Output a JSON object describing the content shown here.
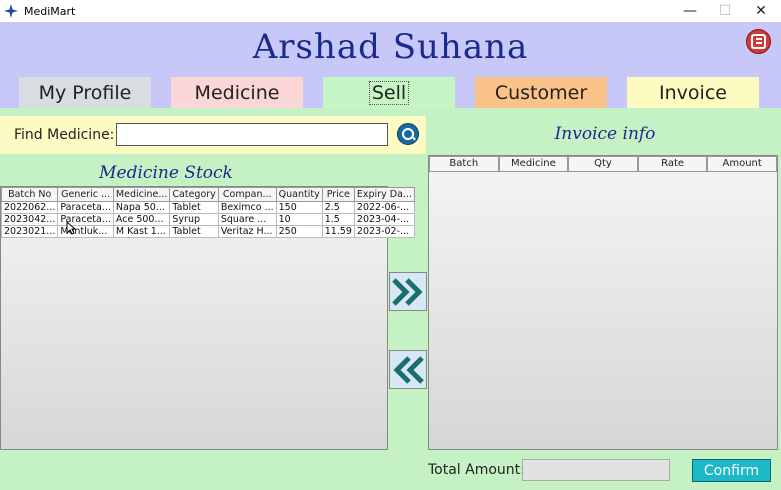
{
  "window": {
    "title": "MediMart",
    "minimize": "—",
    "maximize": "☐",
    "close": "✕"
  },
  "header": {
    "user_name": "Arshad Suhana"
  },
  "tabs": [
    {
      "label": "My Profile"
    },
    {
      "label": "Medicine"
    },
    {
      "label": "Sell"
    },
    {
      "label": "Customer"
    },
    {
      "label": "Invoice"
    }
  ],
  "find": {
    "label": "Find Medicine:",
    "value": ""
  },
  "stock": {
    "title": "Medicine Stock",
    "columns": [
      "Batch No",
      "Generic ...",
      "Medicine...",
      "Category",
      "Compan...",
      "Quantity",
      "Price",
      "Expiry Da..."
    ],
    "rows": [
      [
        "2022062...",
        "Paraceta...",
        "Napa 50...",
        "Tablet",
        "Beximco ...",
        "150",
        "2.5",
        "2022-06-..."
      ],
      [
        "2023042...",
        "Paraceta...",
        "Ace 500...",
        "Syrup",
        "Square ...",
        "10",
        "1.5",
        "2023-04-..."
      ],
      [
        "2023021...",
        "Montluk...",
        "M Kast 1...",
        "Tablet",
        "Veritaz H...",
        "250",
        "11.59",
        "2023-02-..."
      ]
    ]
  },
  "invoice": {
    "title": "Invoice info",
    "columns": [
      "Batch",
      "Medicine",
      "Qty",
      "Rate",
      "Amount"
    ]
  },
  "total": {
    "label": "Total Amount:",
    "value": ""
  },
  "confirm": {
    "label": "Confirm"
  },
  "colors": {
    "header_bg": "#c8c8f8",
    "content_bg": "#c5f2c5",
    "confirm_bg": "#1eb7c5",
    "title_blue": "#1a2a8a"
  }
}
